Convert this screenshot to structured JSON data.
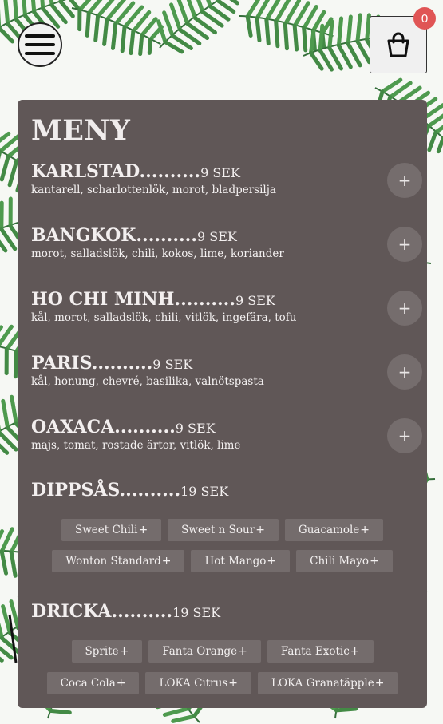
{
  "header": {
    "menu_icon": "hamburger-icon",
    "cart_icon": "shopping-bag-icon",
    "cart_count": "0"
  },
  "menu": {
    "title": "MENY",
    "dots": "..........",
    "plus": "+",
    "items": [
      {
        "name": "KARLSTAD",
        "price": "9 SEK",
        "desc": "kantarell, scharlottenlök, morot, bladpersilja"
      },
      {
        "name": "BANGKOK",
        "price": "9 SEK",
        "desc": "morot, salladslök, chili, kokos, lime, koriander"
      },
      {
        "name": "HO CHI MINH",
        "price": "9 SEK",
        "desc": "kål, morot, salladslök, chili, vitlök, ingefära, tofu"
      },
      {
        "name": "PARIS",
        "price": "9 SEK",
        "desc": "kål, honung, chevré, basilika, valnötspasta"
      },
      {
        "name": "OAXACA",
        "price": "9 SEK",
        "desc": "majs, tomat, rostade ärtor, vitlök, lime"
      }
    ],
    "dips": {
      "name": "DIPPSÅS",
      "price": "19 SEK",
      "options": [
        "Sweet Chili",
        "Sweet n Sour",
        "Guacamole",
        "Wonton Standard",
        "Hot Mango",
        "Chili Mayo"
      ]
    },
    "drinks": {
      "name": "DRICKA",
      "price": "19 SEK",
      "options": [
        "Sprite",
        "Fanta Orange",
        "Fanta Exotic",
        "Coca Cola",
        "LOKA Citrus",
        "LOKA Granatäpple"
      ]
    }
  },
  "colors": {
    "panel": "#605757",
    "button": "#756d6d",
    "badge": "#e05555",
    "leaf_dark": "#2f7d32",
    "leaf_light": "#5aab4f"
  }
}
